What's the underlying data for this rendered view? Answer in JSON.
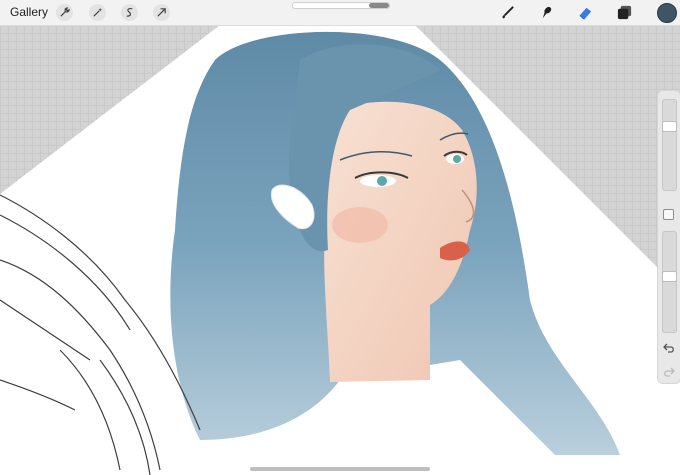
{
  "toolbar": {
    "gallery_label": "Gallery",
    "left_tools": [
      "wrench-icon",
      "magic-wand-icon",
      "selection-s-icon",
      "transform-arrow-icon"
    ],
    "right_tools": [
      "brush-icon",
      "smudge-icon",
      "eraser-icon",
      "layers-icon"
    ],
    "active_tool": "eraser-icon",
    "current_color": "#3f5565"
  },
  "sidebar": {
    "brush_size_level": 0.73,
    "opacity_level": 0.56
  },
  "colors": {
    "hair": "#6f97b0",
    "skin": "#f6d9c9",
    "eraser_active": "#3b7ddd",
    "canvas_background": "#ffffff"
  }
}
